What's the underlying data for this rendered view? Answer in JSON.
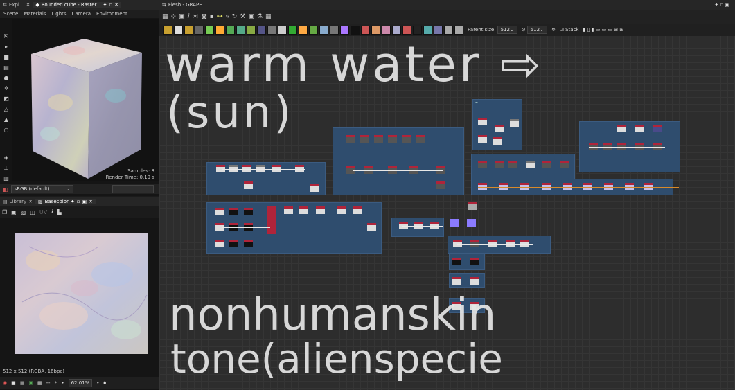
{
  "left_top": {
    "tabs": [
      "Expl...",
      "Rounded cube - Raster..."
    ],
    "menu": [
      "Scene",
      "Materials",
      "Lights",
      "Camera",
      "Environment"
    ],
    "samples": "Samples: 8",
    "render_time": "Render Time: 0.19 s",
    "colorspace": "sRGB (default)"
  },
  "left_bottom": {
    "tabs": [
      "Library",
      "Basecolor"
    ],
    "uv_label": "UV",
    "resolution": "512 x 512 (RGBA, 16bpc)",
    "zoom": "62.01%"
  },
  "graph": {
    "title": "Flesh - GRAPH",
    "parent_size_label": "Parent size:",
    "parent_size_value": "512",
    "size_value": "512",
    "stack_label": "Stack",
    "handwriting": {
      "line1": "warm water ⇨",
      "line2": "(sun)",
      "line3": "nonhumanskin",
      "line4": "tone(alienspecie"
    }
  },
  "colors": {
    "frame_blue": "#2f4d6e",
    "node_red": "#b0243a",
    "wire": "#e8e8e8",
    "accent_orange": "#d88a2a",
    "purple_node": "#8b7bff"
  },
  "icons": [
    "hand-icon",
    "pin-icon",
    "close-icon",
    "cube-icon",
    "settings-icon",
    "play-icon"
  ]
}
